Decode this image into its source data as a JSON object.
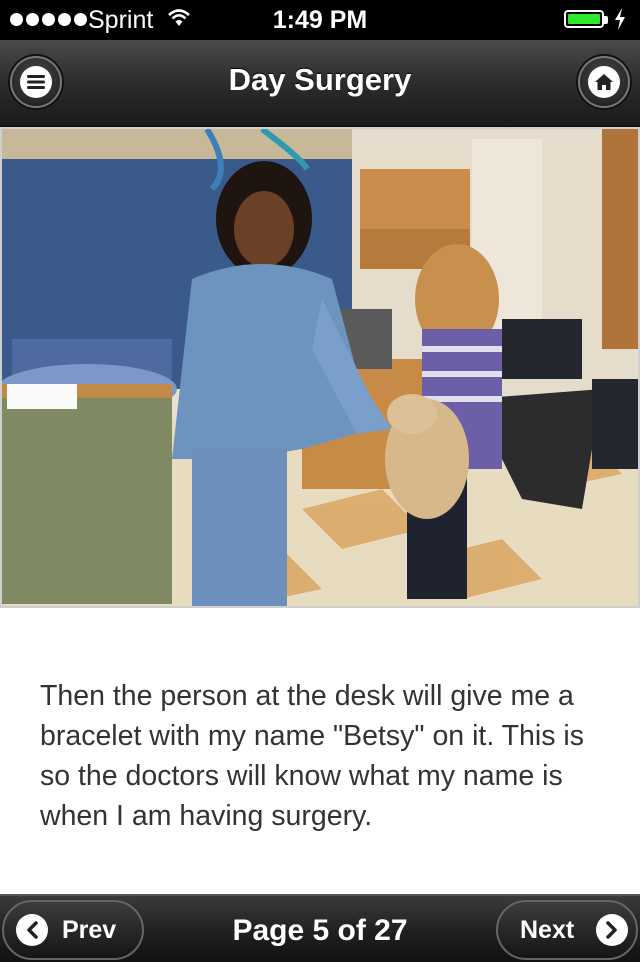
{
  "status_bar": {
    "carrier": "Sprint",
    "time": "1:49 PM",
    "battery_level": 1.0,
    "battery_color": "#2ee82e",
    "signal_dots": 5,
    "icons": [
      "wifi-icon",
      "battery-icon",
      "charging-bolt-icon"
    ]
  },
  "nav": {
    "title": "Day Surgery",
    "menu_icon": "menu-icon",
    "home_icon": "home-icon"
  },
  "photo": {
    "description_icon": "photo"
  },
  "story": {
    "text": "Then the person at the desk will give me a bracelet with my name \"Betsy\" on it. This is so the doctors will know what my name is when I am having surgery."
  },
  "footer": {
    "prev_label": "Prev",
    "next_label": "Next",
    "page_label": "Page 5 of 27",
    "prev_icon": "chevron-left-icon",
    "next_icon": "chevron-right-icon"
  }
}
